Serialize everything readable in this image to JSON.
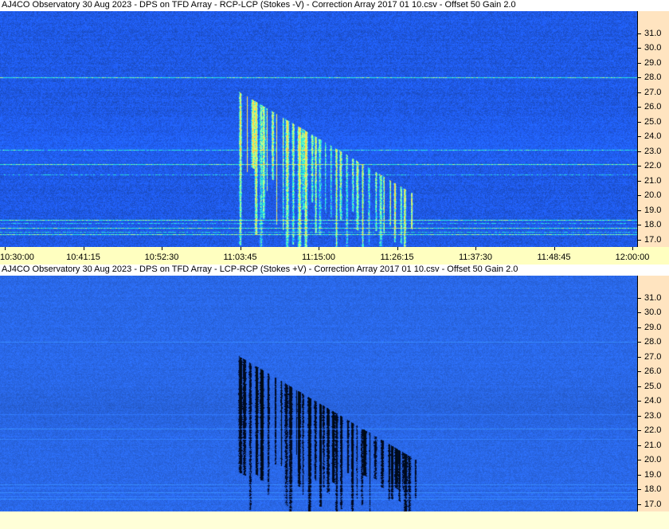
{
  "chart_data": [
    {
      "type": "heatmap",
      "title": "AJ4CO Observatory 30 Aug 2023  -  DPS on TFD Array  -  RCP-LCP (Stokes -V)  -  Correction Array 2017 01 10.csv  -  Offset 50  Gain 2.0",
      "polarity": "positive",
      "y_ticks": [
        "17.0",
        "18.0",
        "19.0",
        "20.0",
        "21.0",
        "22.0",
        "23.0",
        "24.0",
        "25.0",
        "26.0",
        "27.0",
        "28.0",
        "29.0",
        "30.0",
        "31.0"
      ],
      "x_ticks": [
        "10:30:00",
        "10:41:15",
        "10:52:30",
        "11:03:45",
        "11:15:00",
        "11:26:15",
        "11:37:30",
        "11:48:45",
        "12:00:00"
      ],
      "ylim": [
        16.5,
        32.5
      ],
      "xlim": [
        "10:30:00",
        "12:00:00"
      ],
      "burst": {
        "start_time": "11:03:45",
        "end_time": "11:29:00",
        "start_freq_top": 27.0,
        "end_freq_top": 20.0
      },
      "colors": {
        "background": "#1f59e6",
        "burst_high": "#ffd54a",
        "burst_mid": "#33ffcc"
      }
    },
    {
      "type": "heatmap",
      "title": "AJ4CO Observatory 30 Aug 2023  -  DPS on TFD Array  -  LCP-RCP (Stokes +V)  -  Correction Array 2017 01 10.csv  -  Offset 50  Gain 2.0",
      "polarity": "negative",
      "y_ticks": [
        "17.0",
        "18.0",
        "19.0",
        "20.0",
        "21.0",
        "22.0",
        "23.0",
        "24.0",
        "25.0",
        "26.0",
        "27.0",
        "28.0",
        "29.0",
        "30.0",
        "31.0"
      ],
      "x_ticks": [],
      "ylim": [
        16.5,
        32.5
      ],
      "xlim": [
        "10:30:00",
        "12:00:00"
      ],
      "burst": {
        "start_time": "11:03:45",
        "end_time": "11:29:00",
        "start_freq_top": 27.0,
        "end_freq_top": 20.0
      },
      "colors": {
        "background": "#2a68e8",
        "burst_low": "#000814",
        "burst_mid": "#0a1a66"
      }
    }
  ]
}
